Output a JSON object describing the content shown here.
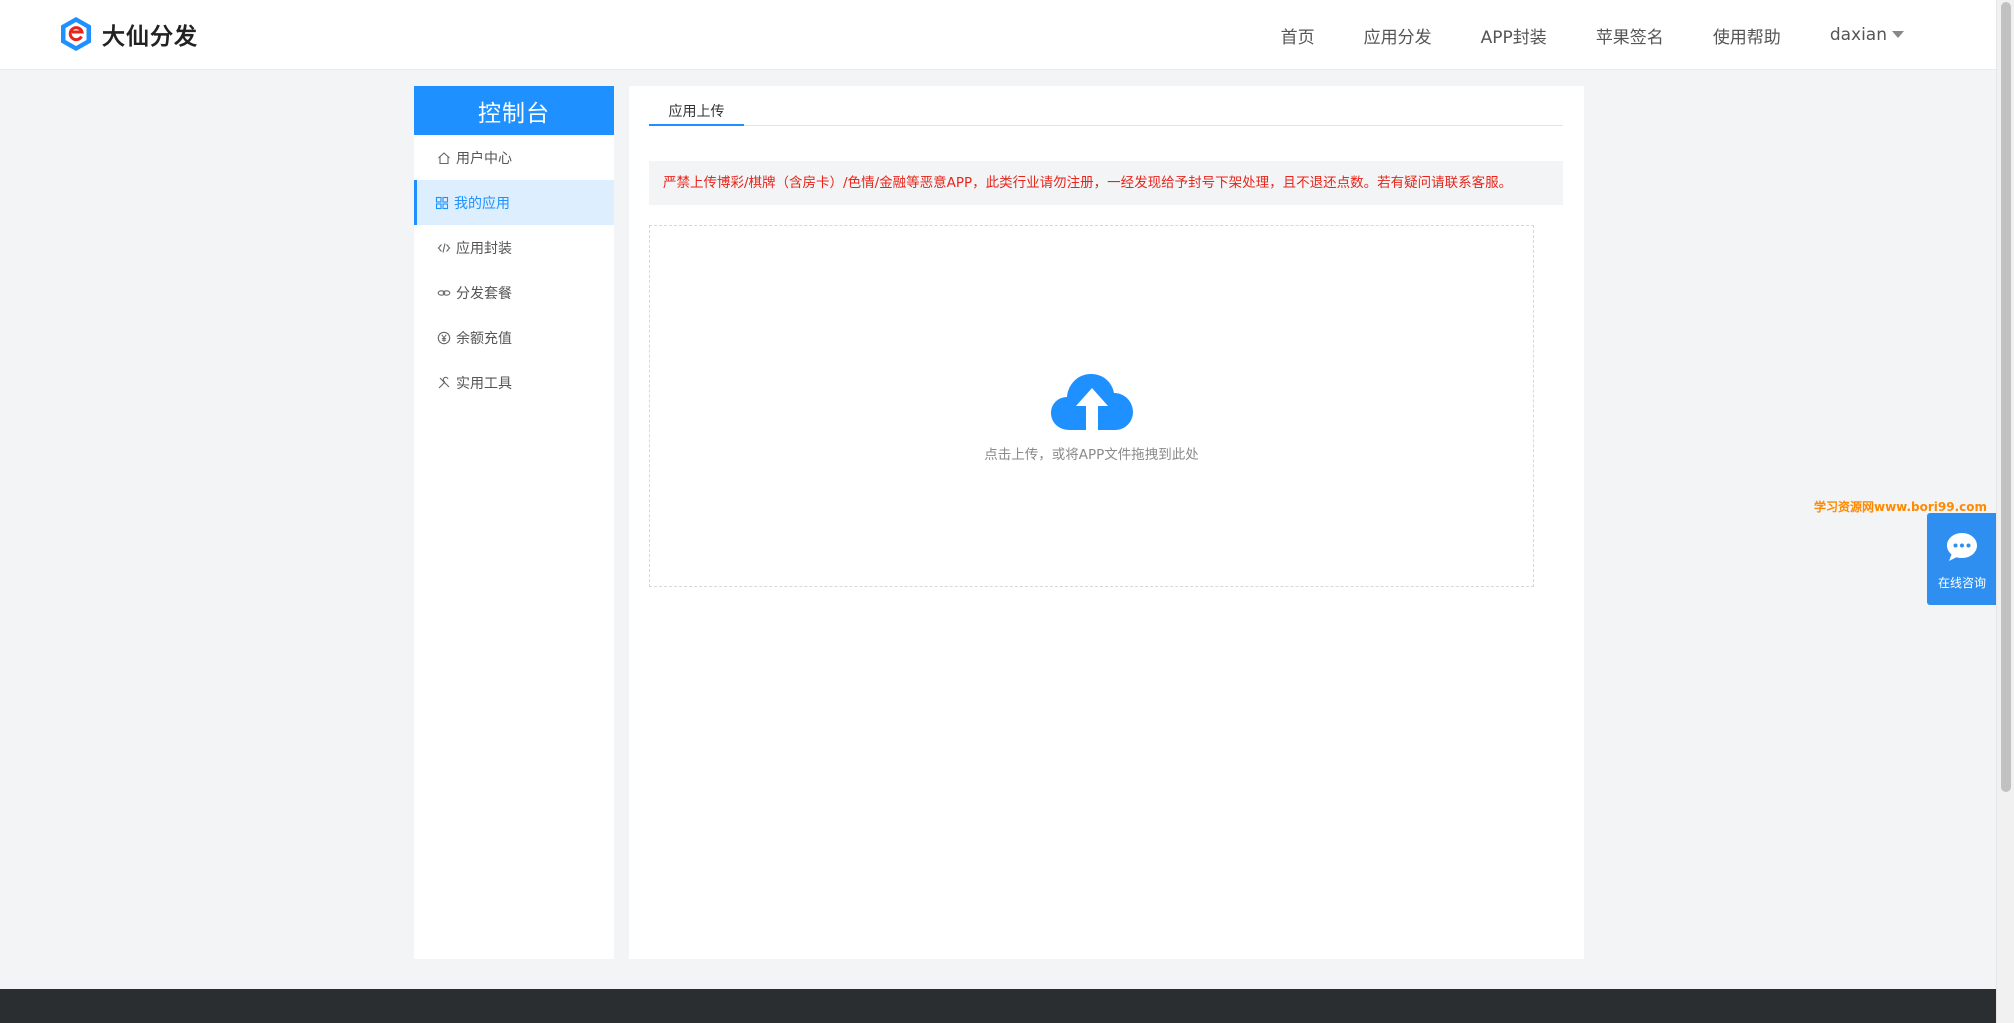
{
  "header": {
    "logo_text": "大仙分发",
    "logo_icon": "hexagon-e-logo-icon",
    "nav": [
      "首页",
      "应用分发",
      "APP封装",
      "苹果签名",
      "使用帮助"
    ],
    "user": "daxian"
  },
  "sidebar": {
    "title": "控制台",
    "items": [
      {
        "label": "用户中心",
        "icon": "home-icon"
      },
      {
        "label": "我的应用",
        "icon": "apps-icon",
        "active": true
      },
      {
        "label": "应用封装",
        "icon": "code-icon"
      },
      {
        "label": "分发套餐",
        "icon": "link-icon"
      },
      {
        "label": "余额充值",
        "icon": "yen-icon"
      },
      {
        "label": "实用工具",
        "icon": "tools-icon"
      }
    ]
  },
  "main": {
    "tab": "应用上传",
    "notice": "严禁上传博彩/棋牌（含房卡）/色情/金融等恶意APP，此类行业请勿注册，一经发现给予封号下架处理，且不退还点数。若有疑问请联系客服。",
    "upload_hint": "点击上传，或将APP文件拖拽到此处",
    "upload_icon": "cloud-upload-icon"
  },
  "watermark": "学习资源网www.bori99.com",
  "float_chat": {
    "label": "在线咨询",
    "icon": "chat-bubble-icon"
  },
  "colors": {
    "accent": "#1e90ff",
    "notice": "#e8251c",
    "footer": "#2b2e31"
  }
}
